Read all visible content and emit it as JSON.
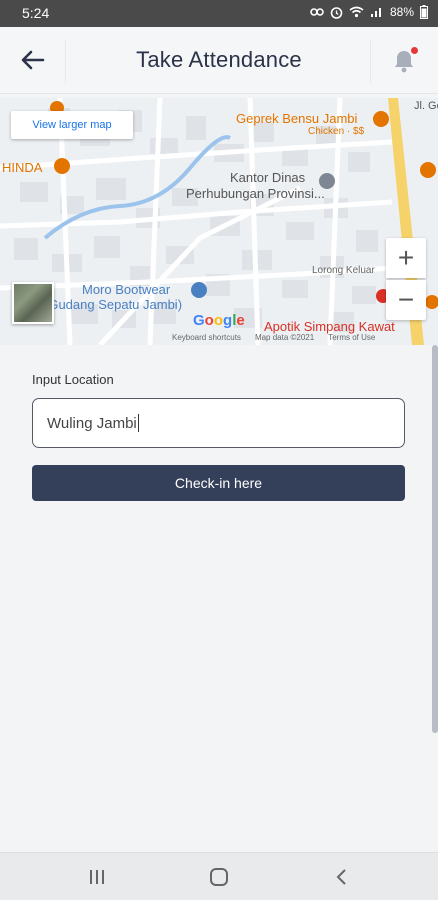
{
  "status_bar": {
    "time": "5:24",
    "battery": "88%"
  },
  "app_bar": {
    "title": "Take Attendance",
    "back_icon": "arrow-left-icon",
    "notification_icon": "bell-icon",
    "notification_dot_color": "#e53935"
  },
  "map": {
    "view_larger_label": "View larger map",
    "labels": {
      "geprek": "Geprek Bensu Jambi",
      "geprek_sub": "Chicken · $$",
      "jl_ge": "Jl. Ge",
      "hinda": "HINDA",
      "kantor1": "Kantor Dinas",
      "kantor2": "Perhubungan Provinsi...",
      "lorong": "Lorong Keluar",
      "moro1": "Moro Bootwear",
      "moro2": "(Gudang Sepatu Jambi)",
      "apotik": "Apotik Simpang Kawat"
    },
    "zoom_in": "+",
    "zoom_out": "−",
    "google": "Google",
    "footer": {
      "shortcuts": "Keyboard shortcuts",
      "data": "Map data ©2021",
      "terms": "Terms of Use"
    }
  },
  "form": {
    "label": "Input Location",
    "value": "Wuling Jambi",
    "button_label": "Check-in here"
  },
  "colors": {
    "primary": "#34405a",
    "title_text": "#2c3348",
    "map_link": "#1a73e8",
    "poi_orange": "#e37400",
    "poi_blue": "#4a80c2",
    "poi_red": "#d93025"
  }
}
